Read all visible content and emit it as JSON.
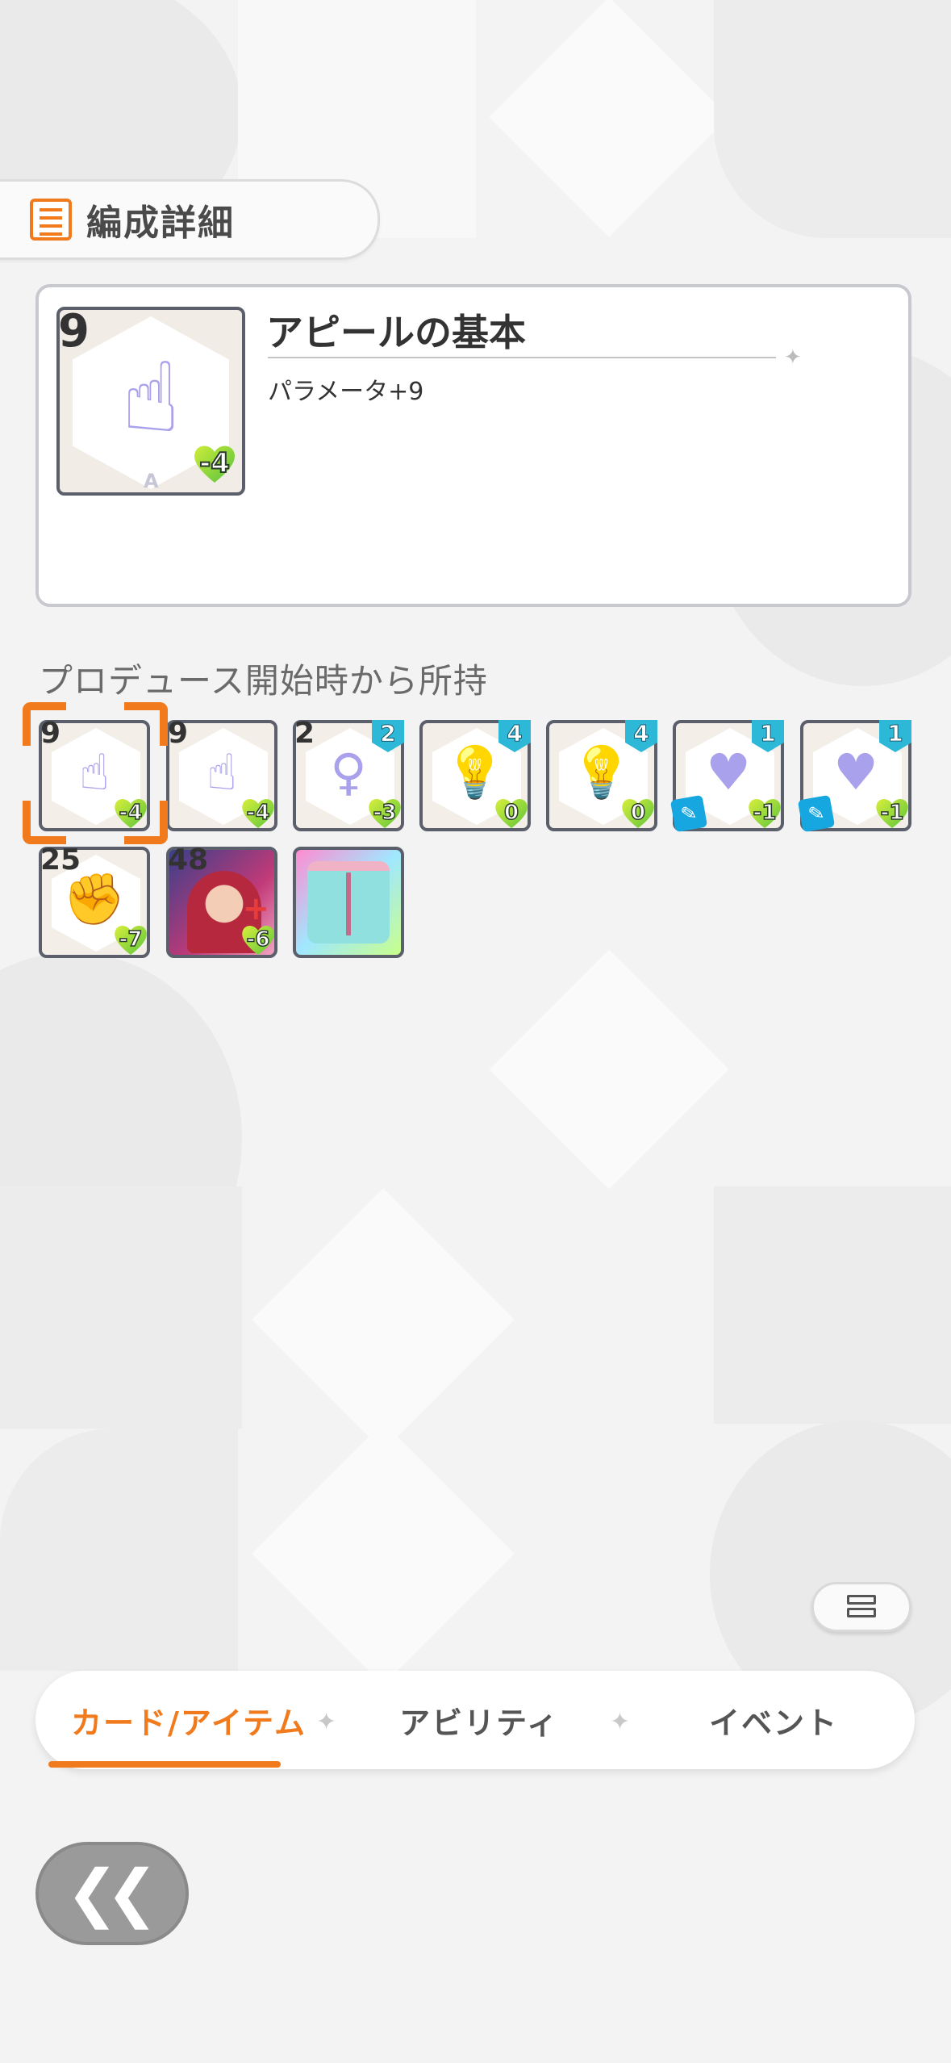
{
  "header": {
    "title": "編成詳細",
    "icon": "list-icon"
  },
  "selected_card": {
    "level": "9",
    "cost": "-4",
    "grade": "A",
    "title": "アピールの基本",
    "description": "パラメータ+9"
  },
  "section": {
    "label": "プロデュース開始時から所持"
  },
  "items": [
    {
      "num": "9",
      "cost": "-4",
      "glyph": "☝",
      "selected": true
    },
    {
      "num": "9",
      "cost": "-4",
      "glyph": "☝"
    },
    {
      "num": "2",
      "lvl": "2",
      "cost": "-3",
      "glyph": "♀"
    },
    {
      "lvl": "4",
      "cost": "0",
      "glyph": "💡"
    },
    {
      "lvl": "4",
      "cost": "0",
      "glyph": "💡"
    },
    {
      "lvl": "1",
      "cost": "-1",
      "glyph": "♥",
      "tag": true
    },
    {
      "lvl": "1",
      "cost": "-1",
      "glyph": "♥",
      "tag": true
    },
    {
      "num": "25",
      "cost": "-7",
      "glyph": "✊"
    },
    {
      "num": "48",
      "cost": "-6",
      "photo": true
    },
    {
      "rainbow": true
    }
  ],
  "tabs": [
    {
      "label": "カード/アイテム",
      "active": true
    },
    {
      "label": "アビリティ"
    },
    {
      "label": "イベント"
    }
  ],
  "colors": {
    "accent": "#f07a1c",
    "level_badge": "#2db8d8"
  }
}
